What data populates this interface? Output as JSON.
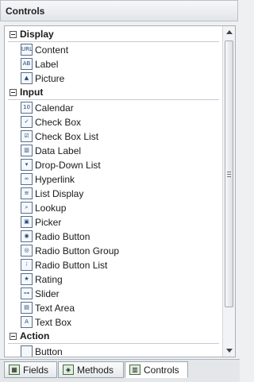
{
  "panel": {
    "title": "Controls"
  },
  "groups": [
    {
      "label": "Display",
      "items": [
        {
          "label": "Content",
          "icon": "url-content-icon",
          "glyph": "URL"
        },
        {
          "label": "Label",
          "icon": "label-icon",
          "glyph": "AB"
        },
        {
          "label": "Picture",
          "icon": "picture-icon",
          "glyph": "▲"
        }
      ]
    },
    {
      "label": "Input",
      "items": [
        {
          "label": "Calendar",
          "icon": "calendar-icon",
          "glyph": "10"
        },
        {
          "label": "Check Box",
          "icon": "checkbox-icon",
          "glyph": "✓"
        },
        {
          "label": "Check Box List",
          "icon": "checkbox-list-icon",
          "glyph": "☑"
        },
        {
          "label": "Data Label",
          "icon": "data-label-icon",
          "glyph": "▥"
        },
        {
          "label": "Drop-Down List",
          "icon": "dropdown-list-icon",
          "glyph": "▾"
        },
        {
          "label": "Hyperlink",
          "icon": "hyperlink-icon",
          "glyph": "∞"
        },
        {
          "label": "List Display",
          "icon": "list-display-icon",
          "glyph": "≡"
        },
        {
          "label": "Lookup",
          "icon": "lookup-icon",
          "glyph": "⌕"
        },
        {
          "label": "Picker",
          "icon": "picker-icon",
          "glyph": "▣"
        },
        {
          "label": "Radio Button",
          "icon": "radio-button-icon",
          "glyph": "◉"
        },
        {
          "label": "Radio Button Group",
          "icon": "radio-button-group-icon",
          "glyph": "◎"
        },
        {
          "label": "Radio Button List",
          "icon": "radio-button-list-icon",
          "glyph": "⁝"
        },
        {
          "label": "Rating",
          "icon": "rating-icon",
          "glyph": "★"
        },
        {
          "label": "Slider",
          "icon": "slider-icon",
          "glyph": "⊶"
        },
        {
          "label": "Text Area",
          "icon": "text-area-icon",
          "glyph": "▤"
        },
        {
          "label": "Text Box",
          "icon": "text-box-icon",
          "glyph": "A"
        }
      ]
    },
    {
      "label": "Action",
      "items": [
        {
          "label": "Button",
          "icon": "button-icon",
          "glyph": ""
        }
      ]
    }
  ],
  "tabs": [
    {
      "label": "Fields",
      "icon": "fields-icon",
      "glyph": "▦",
      "active": false
    },
    {
      "label": "Methods",
      "icon": "methods-icon",
      "glyph": "◈",
      "active": false
    },
    {
      "label": "Controls",
      "icon": "controls-icon",
      "glyph": "▥",
      "active": true
    }
  ]
}
